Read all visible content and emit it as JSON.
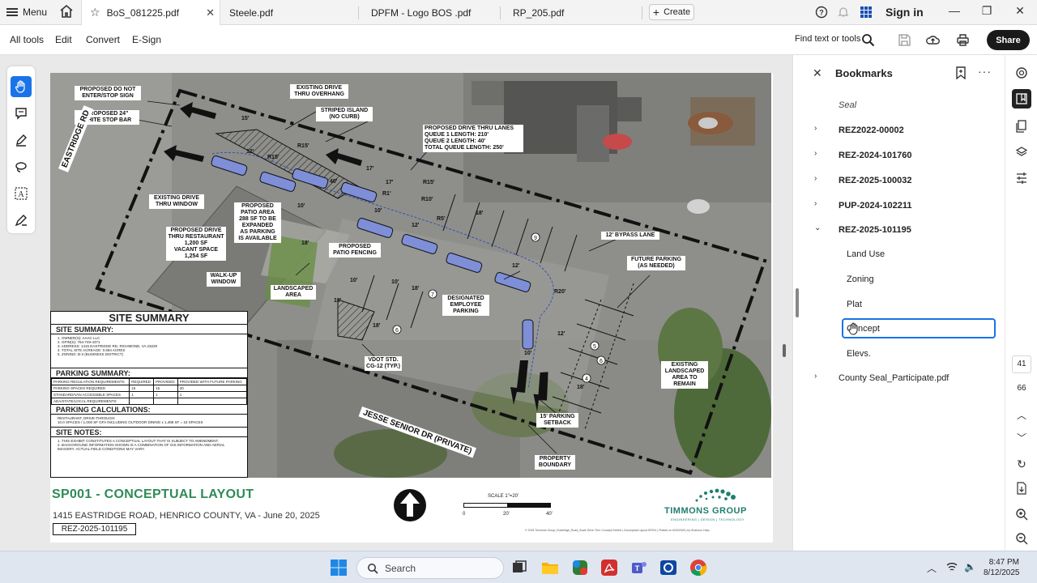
{
  "titlebar": {
    "menu_label": "Menu",
    "tabs": [
      {
        "label": "BoS_081225.pdf",
        "active": true
      },
      {
        "label": "Steele.pdf"
      },
      {
        "label": "DPFM - Logo BOS .pdf"
      },
      {
        "label": "RP_205.pdf"
      }
    ],
    "create_label": "Create",
    "signin_label": "Sign in"
  },
  "toolbar": {
    "items": [
      "All tools",
      "Edit",
      "Convert",
      "E-Sign"
    ],
    "find_label": "Find text or tools",
    "share_label": "Share"
  },
  "document": {
    "callouts": {
      "c1": "PROPOSED DO NOT\nENTER/STOP SIGN",
      "c2": "PROPOSED 24\"\nWHITE STOP BAR",
      "c3": "EXISTING DRIVE\nTHRU OVERHANG",
      "c4": "STRIPED ISLAND\n(NO CURB)",
      "c5": "PROPOSED DRIVE THRU LANES\nQUEUE 1 LENGTH: 210'\nQUEUE 2 LENGTH: 40'\nTOTAL QUEUE LENGTH: 250'",
      "c6": "EXISTING DRIVE\nTHRU WINDOW",
      "c7": "PROPOSED DRIVE\nTHRU RESTAURANT\n1,200 SF\nVACANT SPACE\n1,254 SF",
      "c8": "PROPOSED\nPATIO AREA\n288 SF TO BE\nEXPANDED\nAS PARKING\nIS AVAILABLE",
      "c9": "PROPOSED\nPATIO FENCING",
      "c10": "WALK-UP\nWINDOW",
      "c11": "LANDSCAPED\nAREA",
      "c12": "12' BYPASS LANE",
      "c13": "FUTURE PARKING\n(AS NEEDED)",
      "c14": "DESIGNATED\nEMPLOYEE\nPARKING",
      "c15": "VDOT STD.\nCG-12 (TYP.)",
      "c16": "EXISTING\nLANDSCAPED\nAREA TO\nREMAIN",
      "c17": "15' PARKING\nSETBACK",
      "c18": "PROPERTY\nBOUNDARY"
    },
    "dims": [
      "15'",
      "12'",
      "R15'",
      "R15'",
      "40'",
      "17'",
      "17'",
      "R1'",
      "R15'",
      "R10'",
      "R5'",
      "10'",
      "10'",
      "12'",
      "12'",
      "10'",
      "18'",
      "18'",
      "R20'",
      "12'",
      "10'",
      "18'",
      "18'",
      "10'",
      "18'",
      "18'"
    ],
    "stall_counts": [
      "9",
      "7",
      "6",
      "6",
      "5",
      "4"
    ],
    "streets": {
      "eastridge": "EASTRIDGE RD",
      "jesse": "JESSE SENIOR DR (PRIVATE)"
    },
    "site_summary": {
      "heading": "SITE SUMMARY",
      "sub1": "SITE SUMMARY:",
      "items": "1. OWNER(S): AAAC LLC\n2. GPIN(S): 764-749-4371\n3. ADDRESS: 1415 EASTRIDGE RD, RICHMOND, VA 23229\n4. TOTAL SITE ACREAGE: 0.684 ACRES\n5. ZONING: B-3 (BUSINESS DISTRICT)",
      "parking_heading": "PARKING SUMMARY:",
      "table_head": [
        "PARKING REGULATION REQUIREMENTS",
        "REQUIRED",
        "PROVIDED",
        "PROVIDED WITH FUTURE PARKING"
      ],
      "table_rows": [
        [
          "PARKING SPACES REQUIRED",
          "15",
          "15",
          "20"
        ],
        [
          "STANDARD/VAN ACCESSIBLE SPACES",
          "1",
          "1",
          "1"
        ],
        [
          "ADA/STATE/LOCAL REQUIREMENTS",
          "",
          "",
          ""
        ]
      ],
      "calc_heading": "PARKING CALCULATIONS:",
      "calc_text": "RESTAURANT, DRIVE-THROUGH:\n10.0 SPACES / 1,000 SF GFA INCLUDING OUTDOOR DINING x 1,488 SF = 15 SPACES",
      "notes_heading": "SITE NOTES:",
      "notes_text": "1. THIS EXHIBIT CONSTITUTES A CONCEPTUAL LAYOUT THAT IS SUBJECT TO AMENDMENT.\n2. BACKGROUND INFORMATION SHOWN IS A COMBINATION OF GIS INFORMATION AND AERIAL IMAGERY. ACTUAL FIELD CONDITIONS MAY VARY."
    },
    "plan_title": "SP001 - CONCEPTUAL LAYOUT",
    "address": "1415 EASTRIDGE ROAD, HENRICO COUNTY, VA - June 20, 2025",
    "case_number": "REZ-2025-101195",
    "scale": {
      "label": "SCALE 1\"=20'",
      "ticks": [
        "0",
        "20'",
        "40'"
      ]
    },
    "firm": {
      "name": "TIMMONS GROUP",
      "tagline": "ENGINEERING | DESIGN | TECHNOLOGY"
    },
    "fine_print": "© 2025 Timmons Group | Eastridge_Road_Susie Drive-Thru Concept Exhibit | Conceptual Layout SP001 | Plotted on 6/20/2025 | by Shannon Harp"
  },
  "bookmarks": {
    "title": "Bookmarks",
    "items": [
      {
        "label": "Seal",
        "style": "italic"
      },
      {
        "label": "REZ2022-00002",
        "caret": "right"
      },
      {
        "label": "REZ-2024-101760",
        "caret": "right"
      },
      {
        "label": "REZ-2025-100032",
        "caret": "right"
      },
      {
        "label": "PUP-2024-102211",
        "caret": "right"
      },
      {
        "label": "REZ-2025-101195",
        "caret": "down"
      },
      {
        "label": "Land Use",
        "child": true
      },
      {
        "label": "Zoning",
        "child": true
      },
      {
        "label": "Plat",
        "child": true
      },
      {
        "label": "Concept",
        "child": true,
        "selected": true
      },
      {
        "label": "Elevs.",
        "child": true
      },
      {
        "label": "County Seal_Participate.pdf",
        "caret": "right"
      }
    ]
  },
  "pagination": {
    "current": "41",
    "total": "66"
  },
  "taskbar": {
    "search_placeholder": "Search",
    "time": "8:47 PM",
    "date": "8/12/2025"
  },
  "colors": {
    "accent": "#1a73e8",
    "plan_title": "#2e8b57",
    "firm": "#1f7f6e",
    "pdf_red": "#d32f2f"
  }
}
